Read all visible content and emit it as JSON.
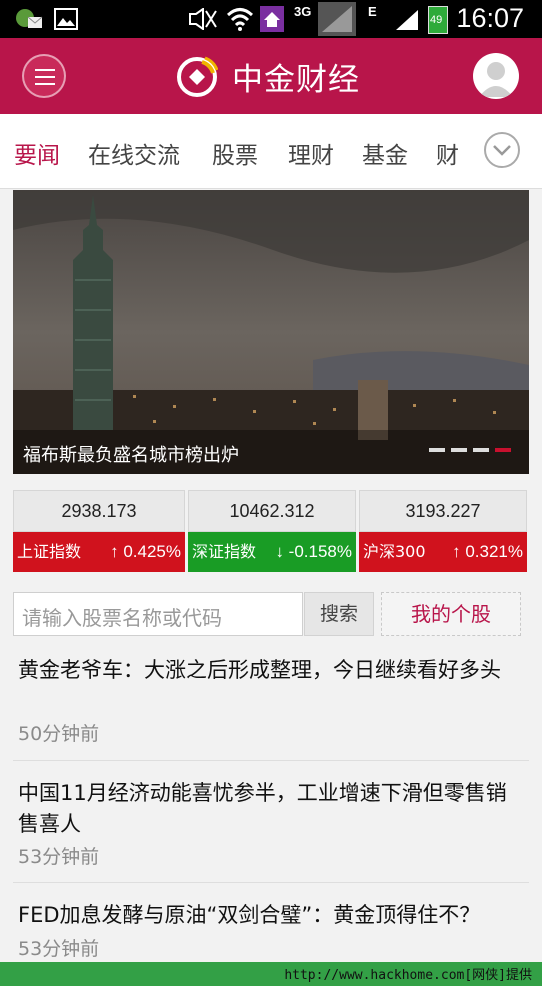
{
  "status_bar": {
    "time": "16:07",
    "network_3g": "3G",
    "network_e": "E",
    "battery": "49",
    "icons": [
      "notification-icon",
      "image-icon",
      "mute-icon",
      "wifi-icon",
      "home-app-icon",
      "signal-icon",
      "signal-icon-2",
      "battery-icon"
    ]
  },
  "header": {
    "title": "中金财经",
    "brand_color": "#b8154a",
    "icons": [
      "menu-icon",
      "logo-icon",
      "user-avatar-icon"
    ]
  },
  "tabs": {
    "items": [
      {
        "label": "要闻",
        "active": true
      },
      {
        "label": "在线交流"
      },
      {
        "label": "股票"
      },
      {
        "label": "理财"
      },
      {
        "label": "基金"
      },
      {
        "label": "财"
      }
    ],
    "more_icon": "chevron-down-icon"
  },
  "banner": {
    "caption": "福布斯最负盛名城市榜出炉",
    "slide_count": 4,
    "active_slide": 4
  },
  "indices": [
    {
      "value": "2938.173",
      "name": "上证指数",
      "arrow": "↑",
      "change": "0.425%",
      "direction": "up"
    },
    {
      "value": "10462.312",
      "name": "深证指数",
      "arrow": "↓",
      "change": "-0.158%",
      "direction": "down"
    },
    {
      "value": "3193.227",
      "name": "沪深300",
      "arrow": "↑",
      "change": "0.321%",
      "direction": "up"
    }
  ],
  "colors": {
    "up": "#d0121d",
    "down": "#199c25"
  },
  "search": {
    "placeholder": "请输入股票名称或代码",
    "button": "搜索",
    "my_stocks": "我的个股"
  },
  "news": [
    {
      "title": "黄金老爷车：大涨之后形成整理，今日继续看好多头",
      "time": "50分钟前"
    },
    {
      "title": "中国11月经济动能喜忧参半，工业增速下滑但零售销售喜人",
      "time": "53分钟前"
    },
    {
      "title": "FED加息发酵与原油“双剑合璧”：黄金顶得住不？",
      "time": "53分钟前"
    }
  ],
  "footer": {
    "watermark": "http://www.hackhome.com[网侠]提供"
  }
}
